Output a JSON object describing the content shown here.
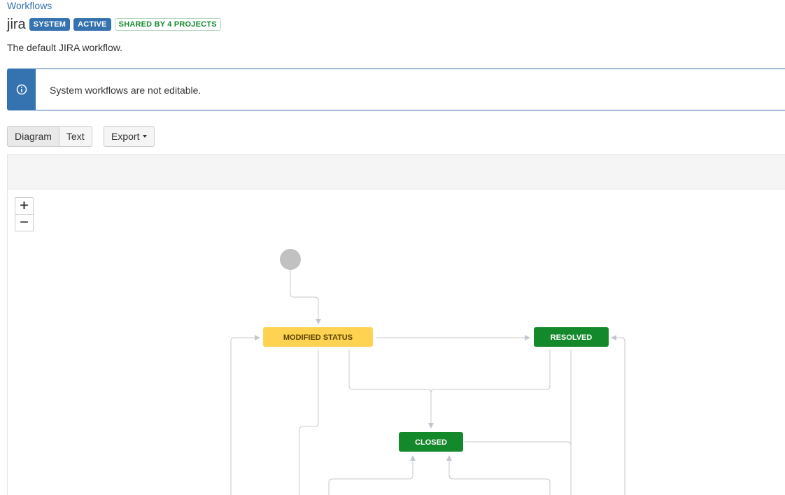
{
  "breadcrumb": "Workflows",
  "workflow": {
    "name": "jira",
    "lozenges": [
      "SYSTEM",
      "ACTIVE",
      "SHARED BY 4 PROJECTS"
    ],
    "description": "The default JIRA workflow."
  },
  "message": {
    "icon": "info-icon",
    "text": "System workflows are not editable."
  },
  "view_toggle": {
    "diagram_label": "Diagram",
    "text_label": "Text",
    "selected": "Diagram"
  },
  "export_label": "Export",
  "zoom": {
    "in_label": "+",
    "out_label": "−"
  },
  "statuses": {
    "modified": "MODIFIED STATUS",
    "resolved": "RESOLVED",
    "closed": "CLOSED"
  },
  "colors": {
    "brand_blue": "#3572b0",
    "status_yellow": "#ffd351",
    "status_green": "#14892c",
    "connector_gray": "#cccccc"
  }
}
